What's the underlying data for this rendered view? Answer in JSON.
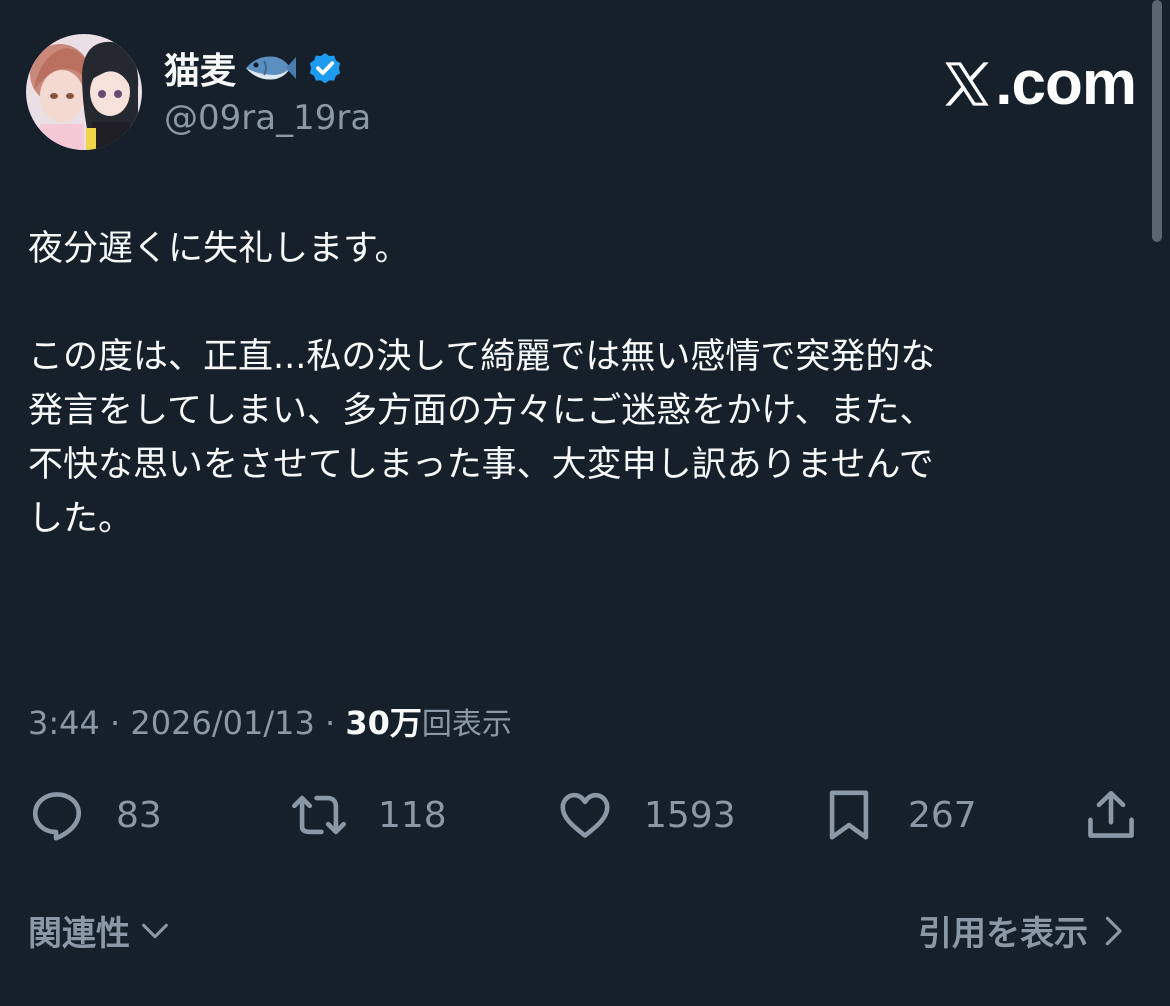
{
  "author": {
    "display_name": "猫麦",
    "handle": "@09ra_19ra"
  },
  "brand": {
    "domain_suffix": ".com"
  },
  "tweet": {
    "lines": [
      "夜分遅くに失礼します。",
      "",
      "この度は、正直...私の決して綺麗では無い感情で突発的な",
      "発言をしてしまい、多方面の方々にご迷惑をかけ、また、",
      "不快な思いをさせてしまった事、大変申し訳ありませんで",
      "した。"
    ]
  },
  "meta": {
    "time": "3:44",
    "separator": " · ",
    "date": "2026/01/13",
    "views_count": "30万",
    "views_label": "回表示"
  },
  "actions": {
    "replies": "83",
    "reposts": "118",
    "likes": "1593",
    "bookmarks": "267"
  },
  "footer": {
    "relevance_label": "関連性",
    "show_quotes_label": "引用を表示"
  },
  "colors": {
    "background": "#15202b",
    "primary_text": "#f7f9f9",
    "secondary_text": "#8b98a5",
    "verified": "#1d9bf0"
  },
  "icons": [
    "fish-icon",
    "verified-badge-icon",
    "x-logo-icon",
    "reply-icon",
    "repost-icon",
    "like-icon",
    "bookmark-icon",
    "share-icon",
    "chevron-down-icon",
    "chevron-right-icon"
  ]
}
